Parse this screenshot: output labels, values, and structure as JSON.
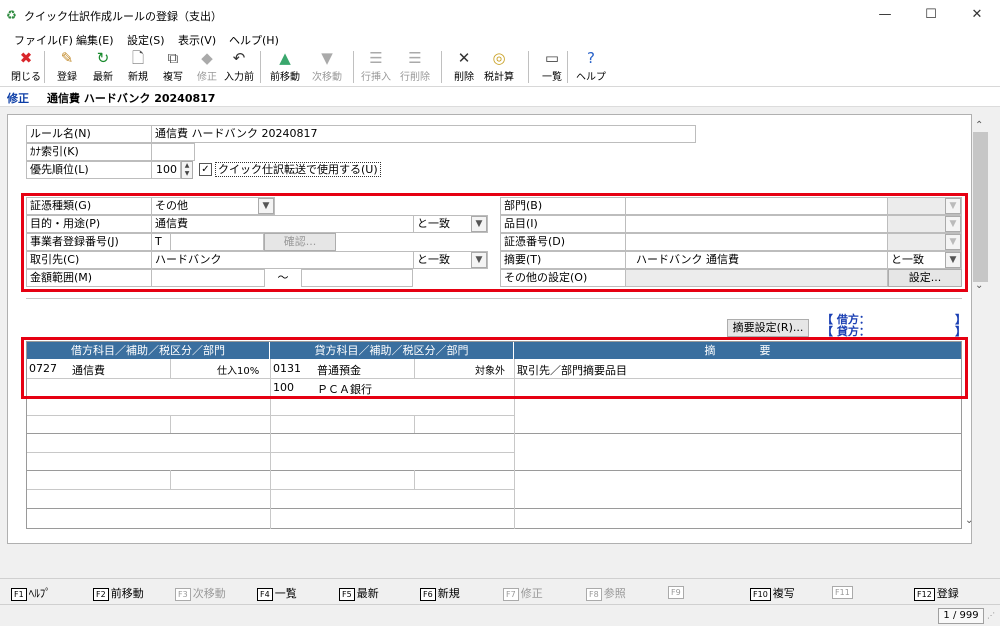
{
  "window": {
    "title": "クイック仕訳作成ルールの登録（支出）",
    "minimize": "—",
    "maximize": "☐",
    "close": "✕"
  },
  "menu": [
    "ファイル(F)",
    "編集(E)",
    "設定(S)",
    "表示(V)",
    "ヘルプ(H)"
  ],
  "toolbar": [
    {
      "label": "閉じる",
      "icon": "close-icon",
      "glyph": "✖",
      "color": "#d9262b",
      "enabled": true
    },
    {
      "label": "登録",
      "icon": "register-icon",
      "glyph": "✎",
      "color": "#c28a2a",
      "enabled": true
    },
    {
      "label": "最新",
      "icon": "refresh-icon",
      "glyph": "↻",
      "color": "#1a8a2e",
      "enabled": true
    },
    {
      "label": "新規",
      "icon": "new-icon",
      "glyph": "🗋",
      "color": "#555",
      "enabled": true
    },
    {
      "label": "複写",
      "icon": "copy-icon",
      "glyph": "⧉",
      "color": "#555",
      "enabled": true
    },
    {
      "label": "修正",
      "icon": "edit-icon",
      "glyph": "◆",
      "color": "#aaa",
      "enabled": false
    },
    {
      "label": "入力前",
      "icon": "undo-icon",
      "glyph": "↶",
      "color": "#333",
      "enabled": true
    },
    {
      "label": "前移動",
      "icon": "move-up-icon",
      "glyph": "▲",
      "color": "#3aa76d",
      "enabled": true
    },
    {
      "label": "次移動",
      "icon": "move-down-icon",
      "glyph": "▼",
      "color": "#aaa",
      "enabled": false
    },
    {
      "label": "行挿入",
      "icon": "insert-row-icon",
      "glyph": "☰",
      "color": "#aaa",
      "enabled": false
    },
    {
      "label": "行削除",
      "icon": "delete-row-icon",
      "glyph": "☰",
      "color": "#aaa",
      "enabled": false
    },
    {
      "label": "削除",
      "icon": "delete-icon",
      "glyph": "✕",
      "color": "#333",
      "enabled": true
    },
    {
      "label": "税計算",
      "icon": "tax-calc-icon",
      "glyph": "◎",
      "color": "#c9a227",
      "enabled": true
    },
    {
      "label": "一覧",
      "icon": "list-icon",
      "glyph": "▭",
      "color": "#444",
      "enabled": true
    },
    {
      "label": "ヘルプ",
      "icon": "help-icon",
      "glyph": "?",
      "color": "#2a63c9",
      "enabled": true
    }
  ],
  "mode": "修正",
  "rule_header": "通信費 ハードバンク 20240817",
  "rule": {
    "name_label": "ルール名(N)",
    "name_value": "通信費 ハードバンク 20240817",
    "kana_label": "ｶﾅ索引(K)",
    "kana_value": "",
    "priority_label": "優先順位(L)",
    "priority_value": "100",
    "quick_transfer_label": "クイック仕訳転送で使用する(U)",
    "quick_transfer_checked": true
  },
  "conditions": {
    "voucher_type_label": "証憑種類(G)",
    "voucher_type_value": "その他",
    "purpose_label": "目的・用途(P)",
    "purpose_value": "通信費",
    "purpose_match": "と一致",
    "reg_no_label": "事業者登録番号(J)",
    "reg_no_prefix": "T",
    "reg_no_value": "",
    "confirm_label": "確認...",
    "partner_label": "取引先(C)",
    "partner_value": "ハードバンク",
    "partner_match": "と一致",
    "amount_label": "金額範囲(M)",
    "amount_from": "",
    "amount_tilde": "～",
    "amount_to": "",
    "dept_label": "部門(B)",
    "dept_value": "",
    "item_label": "品目(I)",
    "item_value": "",
    "voucher_no_label": "証憑番号(D)",
    "voucher_no_value": "",
    "summary_label": "摘要(T)",
    "summary_value": "ハードバンク 通信費",
    "summary_match": "と一致",
    "other_label": "その他の設定(O)",
    "other_button": "設定..."
  },
  "summary_setting_button": "摘要設定(R)...",
  "balance": {
    "debit_label": "【 借方：",
    "credit_label": "【 貸方：",
    "bracket": "】"
  },
  "grid": {
    "headers": [
      "借方科目／補助／税区分／部門",
      "貸方科目／補助／税区分／部門",
      "摘　　　　要"
    ],
    "debit_code": "0727",
    "debit_name": "通信費",
    "debit_tax": "仕入10%",
    "credit_code": "0131",
    "credit_name": "普通預金",
    "credit_tax": "対象外",
    "credit_sub_code": "100",
    "credit_sub_name": "ＰＣＡ銀行",
    "summary": "取引先／部門摘要品目"
  },
  "fkeys": [
    {
      "key": "F1",
      "label": "ﾍﾙﾌﾟ",
      "enabled": true
    },
    {
      "key": "F2",
      "label": "前移動",
      "enabled": true
    },
    {
      "key": "F3",
      "label": "次移動",
      "enabled": false
    },
    {
      "key": "F4",
      "label": "一覧",
      "enabled": true
    },
    {
      "key": "F5",
      "label": "最新",
      "enabled": true
    },
    {
      "key": "F6",
      "label": "新規",
      "enabled": true
    },
    {
      "key": "F7",
      "label": "修正",
      "enabled": false
    },
    {
      "key": "F8",
      "label": "参照",
      "enabled": false
    },
    {
      "key": "F9",
      "label": "",
      "enabled": false
    },
    {
      "key": "F10",
      "label": "複写",
      "enabled": true
    },
    {
      "key": "F11",
      "label": "",
      "enabled": false
    },
    {
      "key": "F12",
      "label": "登録",
      "enabled": true
    }
  ],
  "status": {
    "page": "1 / 999"
  }
}
